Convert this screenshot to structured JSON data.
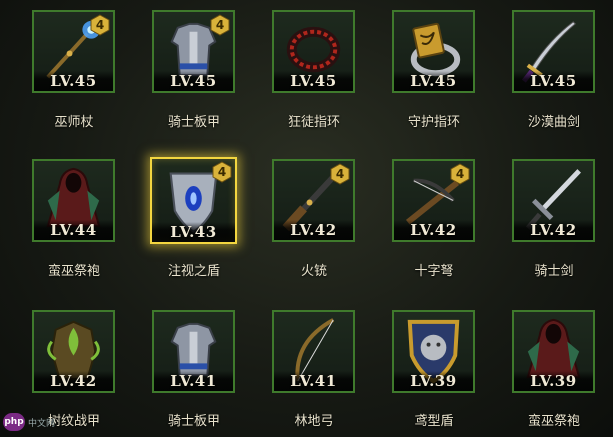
{
  "items": [
    {
      "name": "巫师杖",
      "level": "LV.45",
      "badge": "4",
      "icon": "wizard-staff"
    },
    {
      "name": "骑士板甲",
      "level": "LV.45",
      "badge": "4",
      "icon": "plate-armor"
    },
    {
      "name": "狂徒指环",
      "level": "LV.45",
      "badge": "",
      "icon": "ring-red"
    },
    {
      "name": "守护指环",
      "level": "LV.45",
      "badge": "",
      "icon": "ring-gold"
    },
    {
      "name": "沙漠曲剑",
      "level": "LV.45",
      "badge": "",
      "icon": "scimitar"
    },
    {
      "name": "蛮巫祭袍",
      "level": "LV.44",
      "badge": "",
      "icon": "robe"
    },
    {
      "name": "注视之盾",
      "level": "LV.43",
      "badge": "4",
      "icon": "eye-shield",
      "selected": true
    },
    {
      "name": "火铳",
      "level": "LV.42",
      "badge": "4",
      "icon": "musket"
    },
    {
      "name": "十字弩",
      "level": "LV.42",
      "badge": "4",
      "icon": "crossbow"
    },
    {
      "name": "骑士剑",
      "level": "LV.42",
      "badge": "",
      "icon": "knight-sword"
    },
    {
      "name": "树纹战甲",
      "level": "LV.42",
      "badge": "",
      "icon": "tree-armor"
    },
    {
      "name": "骑士板甲",
      "level": "LV.41",
      "badge": "",
      "icon": "plate-armor"
    },
    {
      "name": "林地弓",
      "level": "LV.41",
      "badge": "",
      "icon": "longbow"
    },
    {
      "name": "鸢型盾",
      "level": "LV.39",
      "badge": "",
      "icon": "lion-shield"
    },
    {
      "name": "蛮巫祭袍",
      "level": "LV.39",
      "badge": "",
      "icon": "robe"
    }
  ],
  "watermark": {
    "logo": "php",
    "site": "中文网"
  },
  "colors": {
    "slot_border": "#3f7a2c",
    "selected_border": "#f3d640",
    "badge": "#d9b23a"
  }
}
